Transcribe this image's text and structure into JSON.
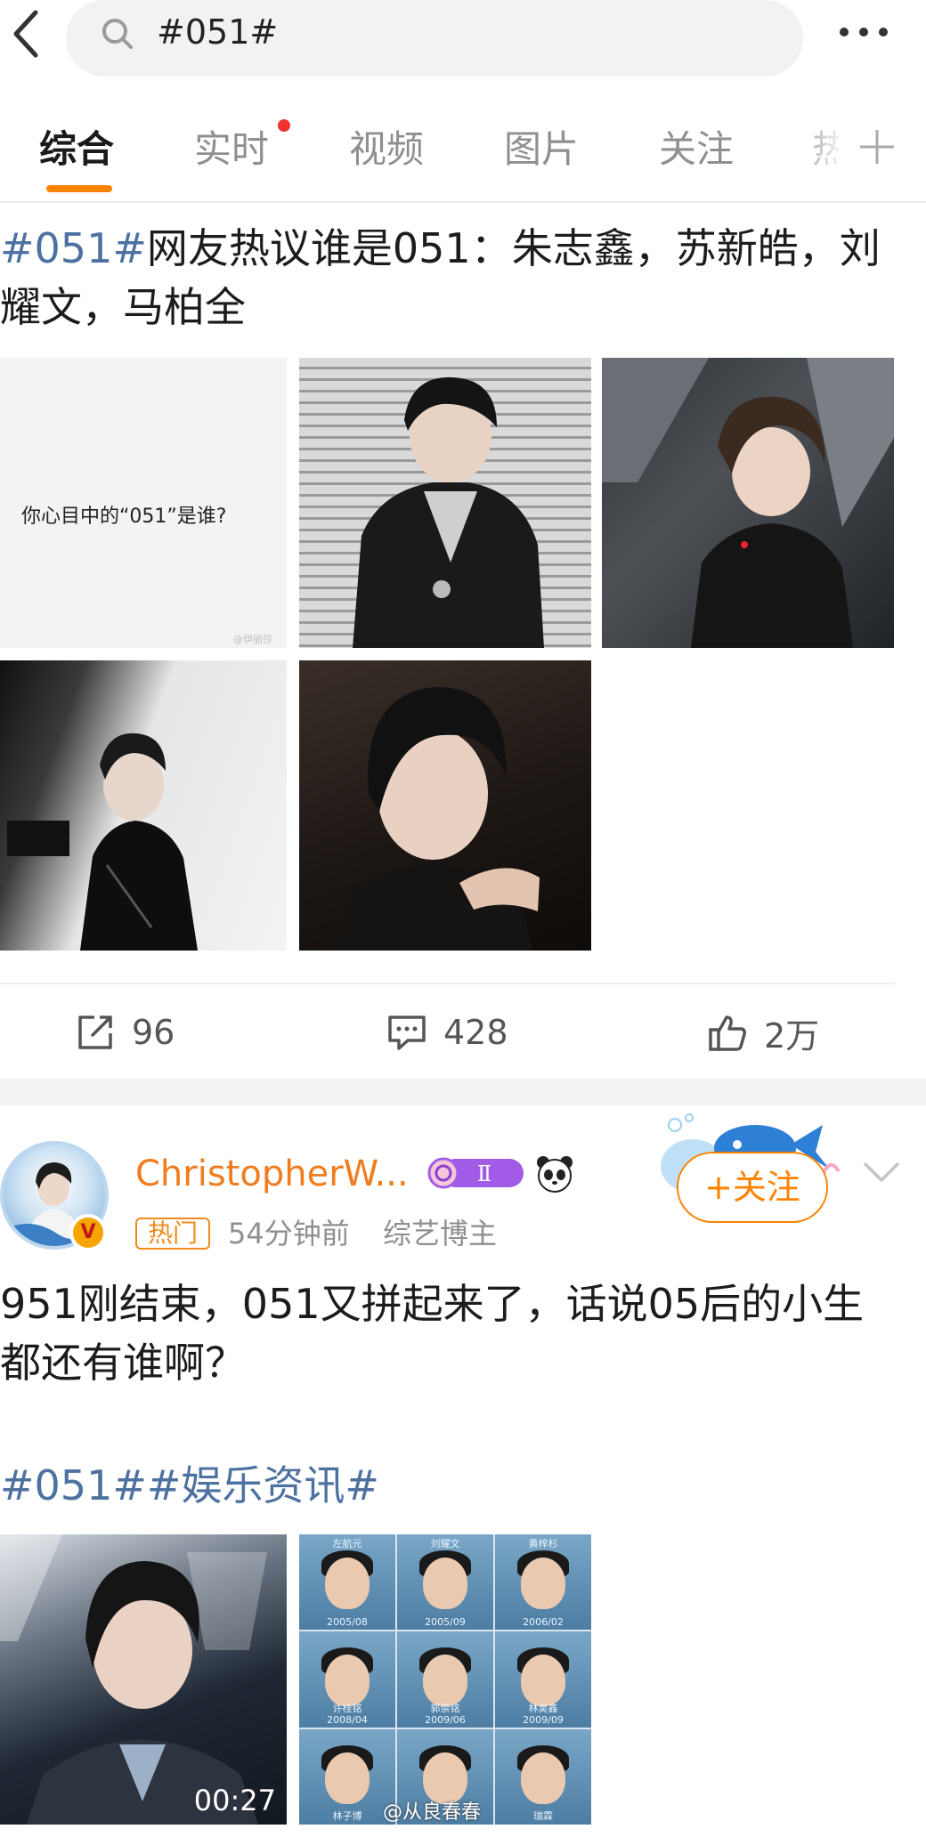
{
  "search": {
    "query": "#051#"
  },
  "tabs": [
    {
      "label": "综合"
    },
    {
      "label": "实时"
    },
    {
      "label": "视频"
    },
    {
      "label": "图片"
    },
    {
      "label": "关注"
    },
    {
      "label": "热"
    }
  ],
  "post1": {
    "hashtag": "#051#",
    "text": "网友热议谁是051：朱志鑫，苏新皓，刘耀文，马柏全",
    "image1_text": "你心目中的“051”是谁?",
    "image1_watermark": "@伊丽莎",
    "actions": {
      "reposts": "96",
      "comments": "428",
      "likes": "2万"
    }
  },
  "post2": {
    "username": "ChristopherW...",
    "level": "Ⅱ",
    "verified_mark": "V",
    "hot_tag": "热门",
    "time": "54分钟前",
    "category": "综艺博主",
    "follow_label": "+关注",
    "text": "951刚结束，051又拼起来了，话说05后的小生都还有谁啊？",
    "hashtags": "#051##娱乐资讯#",
    "video_duration": "00:27",
    "grid_captions": [
      {
        "name": "左航元",
        "date": "2005/08"
      },
      {
        "name": "刘耀文",
        "date": "2005/09"
      },
      {
        "name": "黄梓杉",
        "date": "2006/02"
      },
      {
        "name": "许桂铭",
        "date": "2008/04"
      },
      {
        "name": "郭崇铭",
        "date": "2009/06"
      },
      {
        "name": "林昊鑫",
        "date": "2009/09"
      },
      {
        "name": "林子博",
        "date": ""
      },
      {
        "name": "",
        "date": ""
      },
      {
        "name": "瑞霖",
        "date": ""
      }
    ],
    "image_watermark": "@从良春春"
  }
}
